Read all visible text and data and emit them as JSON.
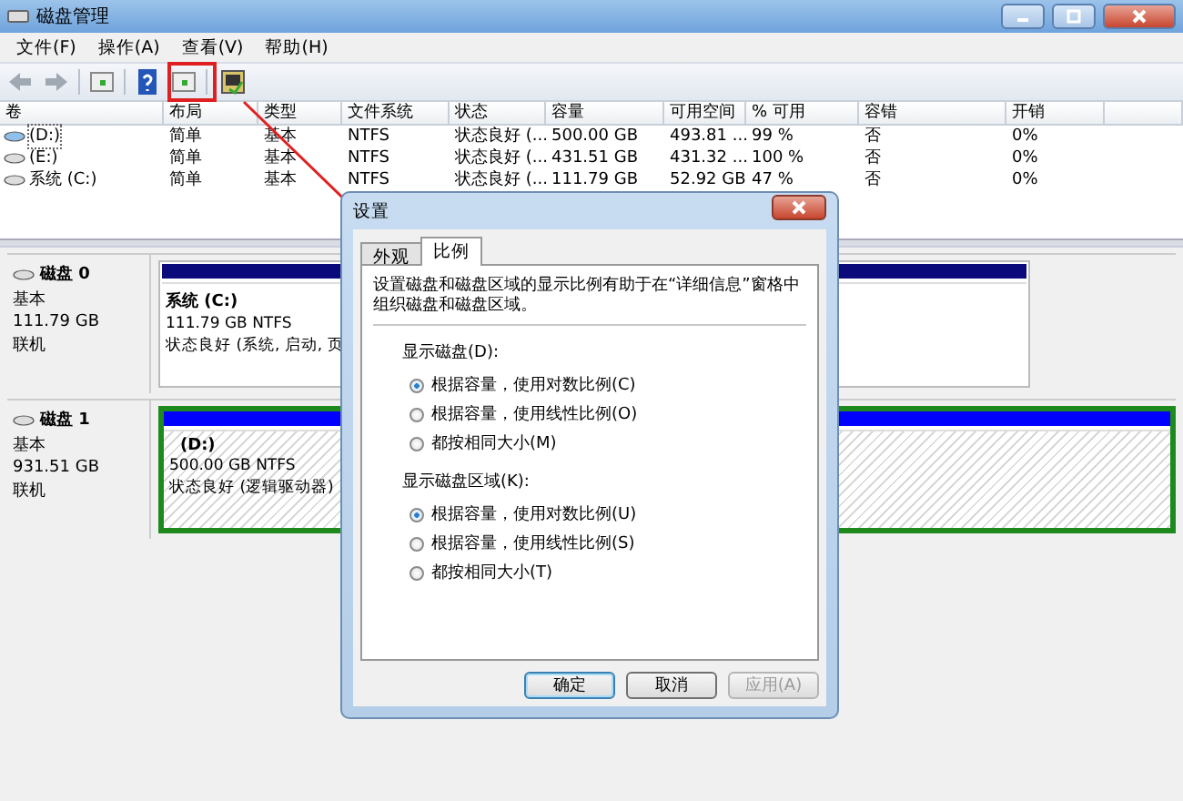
{
  "window": {
    "title": "磁盘管理"
  },
  "menu": [
    "文件(F)",
    "操作(A)",
    "查看(V)",
    "帮助(H)"
  ],
  "table": {
    "columns": [
      "卷",
      "布局",
      "类型",
      "文件系统",
      "状态",
      "容量",
      "可用空间",
      "% 可用",
      "容错",
      "开销"
    ],
    "rows": [
      {
        "cells": [
          "(D:)",
          "简单",
          "基本",
          "NTFS",
          "状态良好 (...",
          "500.00 GB",
          "493.81 ...",
          "99 %",
          "否",
          "0%"
        ],
        "selected": true
      },
      {
        "cells": [
          "(E:)",
          "简单",
          "基本",
          "NTFS",
          "状态良好 (...",
          "431.51 GB",
          "431.32 ...",
          "100 %",
          "否",
          "0%"
        ],
        "selected": false
      },
      {
        "cells": [
          "系统 (C:)",
          "简单",
          "基本",
          "NTFS",
          "状态良好 (...",
          "111.79 GB",
          "52.92 GB",
          "47 %",
          "否",
          "0%"
        ],
        "selected": false
      }
    ]
  },
  "disks": [
    {
      "name": "磁盘 0",
      "type": "基本",
      "size": "111.79 GB",
      "status": "联机",
      "partition": {
        "name": "系统  (C:)",
        "info": "111.79 GB NTFS",
        "status": "状态良好 (系统, 启动, 页",
        "kind": "primary"
      }
    },
    {
      "name": "磁盘 1",
      "type": "基本",
      "size": "931.51 GB",
      "status": "联机",
      "partition": {
        "name": "(D:)",
        "info": "500.00 GB NTFS",
        "status": "状态良好 (逻辑驱动器)",
        "kind": "logical"
      }
    }
  ],
  "dialog": {
    "title": "设置",
    "tabs": [
      {
        "label": "外观",
        "selected": false
      },
      {
        "label": "比例",
        "selected": true
      }
    ],
    "description": "设置磁盘和磁盘区域的显示比例有助于在“详细信息”窗格中组织磁盘和磁盘区域。",
    "groups": [
      {
        "label": "显示磁盘(D):",
        "options": [
          {
            "label": "根据容量，使用对数比例(C)",
            "selected": true
          },
          {
            "label": "根据容量，使用线性比例(O)",
            "selected": false
          },
          {
            "label": "都按相同大小(M)",
            "selected": false
          }
        ]
      },
      {
        "label": "显示磁盘区域(K):",
        "options": [
          {
            "label": "根据容量，使用对数比例(U)",
            "selected": true
          },
          {
            "label": "根据容量，使用线性比例(S)",
            "selected": false
          },
          {
            "label": "都按相同大小(T)",
            "selected": false
          }
        ]
      }
    ],
    "buttons": [
      {
        "label": "确定",
        "disabled": false,
        "default": true
      },
      {
        "label": "取消",
        "disabled": false,
        "default": false
      },
      {
        "label": "应用(A)",
        "disabled": true,
        "default": false
      }
    ]
  }
}
